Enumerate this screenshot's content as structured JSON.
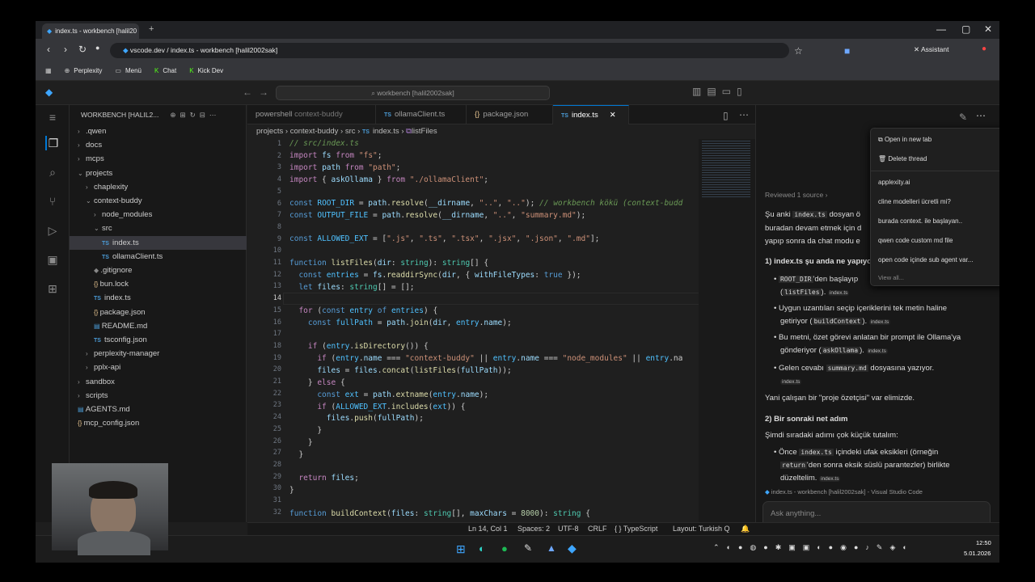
{
  "browser": {
    "tab_title": "index.ts - workbench [halil20",
    "url": "vscode.dev / index.ts - workbench [halil2002sak]",
    "assistant": "Assistant",
    "bookmarks": [
      "Perplexity",
      "Menü",
      "Chat",
      "Kick Dev"
    ]
  },
  "titlebar": {
    "search": "workbench [halil2002sak]"
  },
  "explorer": {
    "header": "WORKBENCH [HALIL2...",
    "items": [
      {
        "label": ".qwen",
        "depth": 0,
        "type": "folder",
        "open": false
      },
      {
        "label": "docs",
        "depth": 0,
        "type": "folder",
        "open": false
      },
      {
        "label": "mcps",
        "depth": 0,
        "type": "folder",
        "open": false
      },
      {
        "label": "projects",
        "depth": 0,
        "type": "folder",
        "open": true
      },
      {
        "label": "chaplexity",
        "depth": 1,
        "type": "folder",
        "open": false
      },
      {
        "label": "context-buddy",
        "depth": 1,
        "type": "folder",
        "open": true
      },
      {
        "label": "node_modules",
        "depth": 2,
        "type": "folder",
        "open": false
      },
      {
        "label": "src",
        "depth": 2,
        "type": "folder",
        "open": true
      },
      {
        "label": "index.ts",
        "depth": 3,
        "type": "ts",
        "sel": true
      },
      {
        "label": "ollamaClient.ts",
        "depth": 3,
        "type": "ts"
      },
      {
        "label": ".gitignore",
        "depth": 2,
        "type": "git"
      },
      {
        "label": "bun.lock",
        "depth": 2,
        "type": "json"
      },
      {
        "label": "index.ts",
        "depth": 2,
        "type": "ts"
      },
      {
        "label": "package.json",
        "depth": 2,
        "type": "json"
      },
      {
        "label": "README.md",
        "depth": 2,
        "type": "md"
      },
      {
        "label": "tsconfig.json",
        "depth": 2,
        "type": "ts"
      },
      {
        "label": "perplexity-manager",
        "depth": 1,
        "type": "folder",
        "open": false
      },
      {
        "label": "pplx-api",
        "depth": 1,
        "type": "folder",
        "open": false
      },
      {
        "label": "sandbox",
        "depth": 0,
        "type": "folder",
        "open": false
      },
      {
        "label": "scripts",
        "depth": 0,
        "type": "folder",
        "open": false
      },
      {
        "label": "AGENTS.md",
        "depth": 0,
        "type": "md"
      },
      {
        "label": "mcp_config.json",
        "depth": 0,
        "type": "json"
      }
    ]
  },
  "editor": {
    "tabs": [
      {
        "icon": "",
        "label": "powershell",
        "hint": "context-buddy"
      },
      {
        "icon": "TS",
        "label": "ollamaClient.ts",
        "hint": ""
      },
      {
        "icon": "{}",
        "label": "package.json",
        "hint": ""
      },
      {
        "icon": "TS",
        "label": "index.ts",
        "hint": "",
        "active": true
      }
    ],
    "breadcrumb": {
      "p1": "projects",
      "p2": "context-buddy",
      "p3": "src",
      "p4": "index.ts",
      "p5": "listFiles"
    },
    "line_numbers": [
      "1",
      "2",
      "3",
      "4",
      "5",
      "6",
      "7",
      "8",
      "9",
      "10",
      "11",
      "12",
      "13",
      "14",
      "15",
      "16",
      "17",
      "18",
      "19",
      "20",
      "21",
      "22",
      "23",
      "24",
      "25",
      "26",
      "27",
      "28",
      "29",
      "30",
      "31",
      "32"
    ]
  },
  "status": {
    "position": "Ln 14, Col 1",
    "spaces": "Spaces: 2",
    "encoding": "UTF-8",
    "eol": "CRLF",
    "lang": "{ } TypeScript",
    "layout": "Layout: Turkish Q"
  },
  "chat": {
    "reviewed": "Reviewed 1 source",
    "p1a": "Şu anki",
    "p1b": "index.ts",
    "p1c": "dosyan ö",
    "p2": "buradan devam etmek için d",
    "p3": "yapıp sonra da chat modu e",
    "h1": "1) index.ts şu anda ne yapıyo",
    "b1a": "ROOT_DIR",
    "b1b": "'den başlayıp",
    "b1c": "listFiles",
    "b1d": ").",
    "ref": "index.ts",
    "b2a": "Uygun uzantıları seçip içeriklerini tek metin haline",
    "b2b": "getiriyor (",
    "b2c": "buildContext",
    "b2d": ").",
    "b3a": "Bu metni, özet görevi anlatan bir prompt ile Ollama'ya",
    "b3b": "gönderiyor (",
    "b3c": "askOllama",
    "b3d": ").",
    "b4a": "Gelen cevabı",
    "b4b": "summary.md",
    "b4c": "dosyasına yazıyor.",
    "p4": "Yani çalışan bir \"proje özetçisi\" var elimizde.",
    "h2": "2) Bir sonraki net adım",
    "p5": "Şimdi sıradaki adımı çok küçük tutalım:",
    "b5a": "Önce",
    "b5b": "index.ts",
    "b5c": "içindeki ufak eksikleri (örneğin",
    "b5d": "return",
    "b5e": "'den sonra eksik süslü parantezler) birlikte",
    "b5f": "düzeltelim.",
    "context": "index.ts - workbench [halil2002sak] - Visual Studio Code",
    "input_placeholder": "Ask anything..."
  },
  "menu": {
    "items": [
      "Open in new tab",
      "Delete thread",
      "applexity.ai",
      "cline modelleri ücretli mi?",
      "burada context. ile başlayan..",
      "qwen code custom md file",
      "open code içinde sub agent var...",
      "View all..."
    ]
  },
  "taskbar": {
    "time": "12:50",
    "date": "5.01.2026"
  },
  "colors": {
    "accent": "#0078d4",
    "bg": "#1f1f1f"
  }
}
